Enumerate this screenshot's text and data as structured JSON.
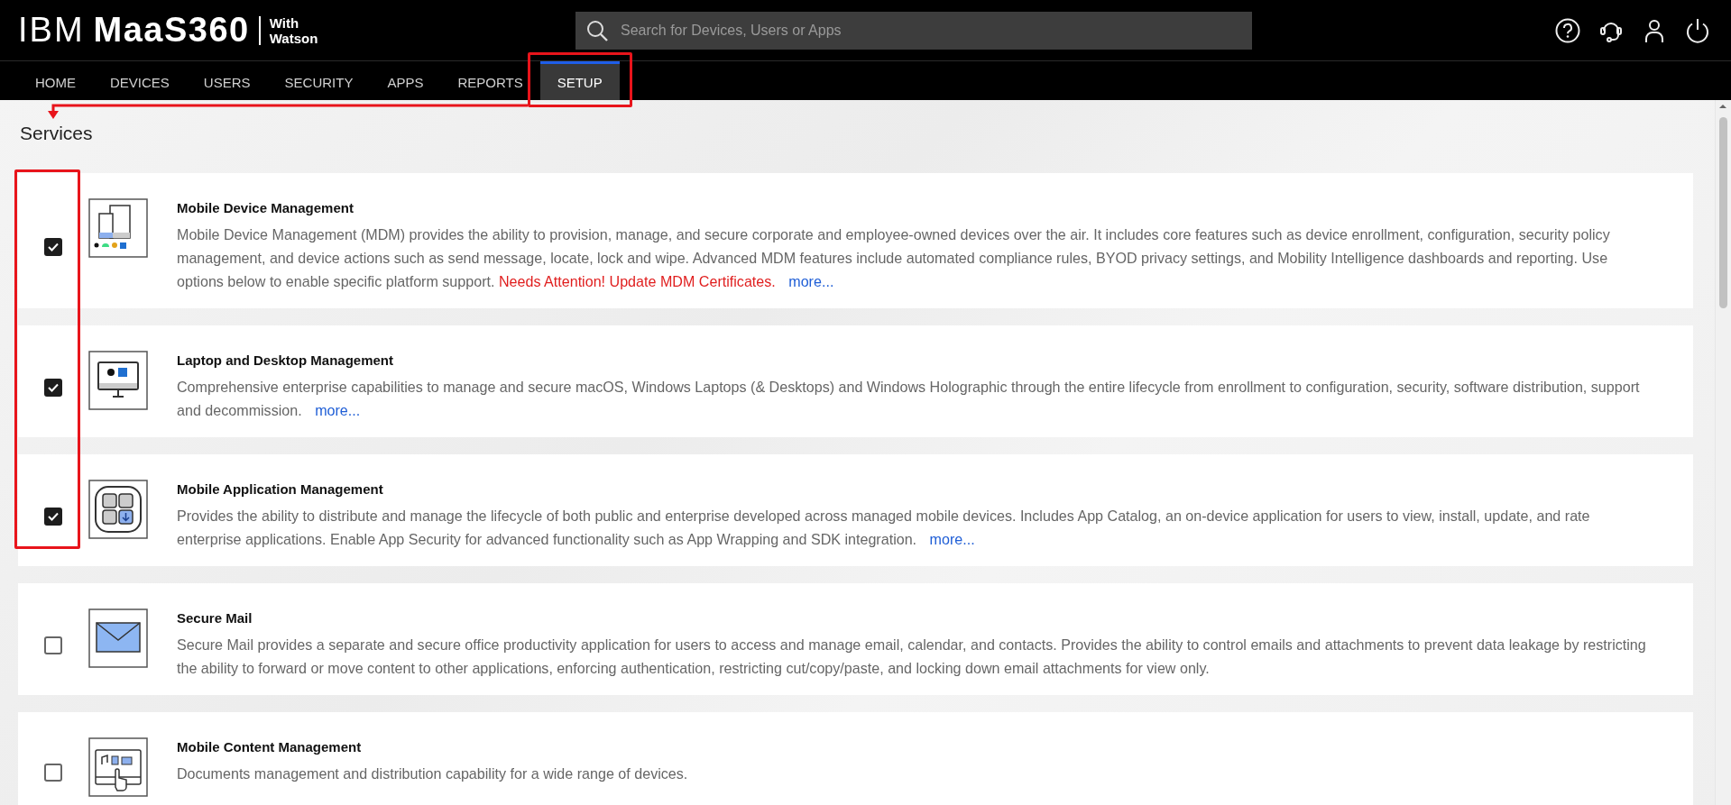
{
  "header": {
    "logo": {
      "brand": "IBM",
      "product": "MaaS360",
      "tagline_lines": [
        "With",
        "Watson"
      ]
    },
    "search": {
      "placeholder": "Search for Devices, Users or Apps"
    }
  },
  "nav": {
    "tabs": [
      {
        "label": "HOME",
        "selected": false
      },
      {
        "label": "DEVICES",
        "selected": false
      },
      {
        "label": "USERS",
        "selected": false
      },
      {
        "label": "SECURITY",
        "selected": false
      },
      {
        "label": "APPS",
        "selected": false
      },
      {
        "label": "REPORTS",
        "selected": false
      },
      {
        "label": "SETUP",
        "selected": true
      }
    ]
  },
  "page_title": "Services",
  "services": [
    {
      "title": "Mobile Device Management",
      "checked": true,
      "description": "Mobile Device Management (MDM) provides the ability to provision, manage, and secure corporate and employee-owned devices over the air. It includes core features such as device enrollment, configuration, security policy management, and device actions such as send message, locate, lock and wipe. Advanced MDM features include automated compliance rules, BYOD privacy settings, and Mobility Intelligence dashboards and reporting. Use options below to enable specific platform support.",
      "alert": "Needs Attention! Update MDM Certificates.",
      "more": "more..."
    },
    {
      "title": "Laptop and Desktop Management",
      "checked": true,
      "description": "Comprehensive enterprise capabilities to manage and secure macOS, Windows Laptops (& Desktops) and Windows Holographic through the entire lifecycle from enrollment to configuration, security, software distribution, support and decommission.",
      "more": "more..."
    },
    {
      "title": "Mobile Application Management",
      "checked": true,
      "description": "Provides the ability to distribute and manage the lifecycle of both public and enterprise developed across managed mobile devices. Includes App Catalog, an on-device application for users to view, install, update, and rate enterprise applications. Enable App Security for advanced functionality such as App Wrapping and SDK integration.",
      "more": "more..."
    },
    {
      "title": "Secure Mail",
      "checked": false,
      "description": "Secure Mail provides a separate and secure office productivity application for users to access and manage email, calendar, and contacts. Provides the ability to control emails and attachments to prevent data leakage by restricting the ability to forward or move content to other applications, enforcing authentication, restricting cut/copy/paste, and locking down email attachments for view only."
    },
    {
      "title": "Mobile Content Management",
      "checked": false,
      "description": "Documents management and distribution capability for a wide range of devices."
    }
  ]
}
